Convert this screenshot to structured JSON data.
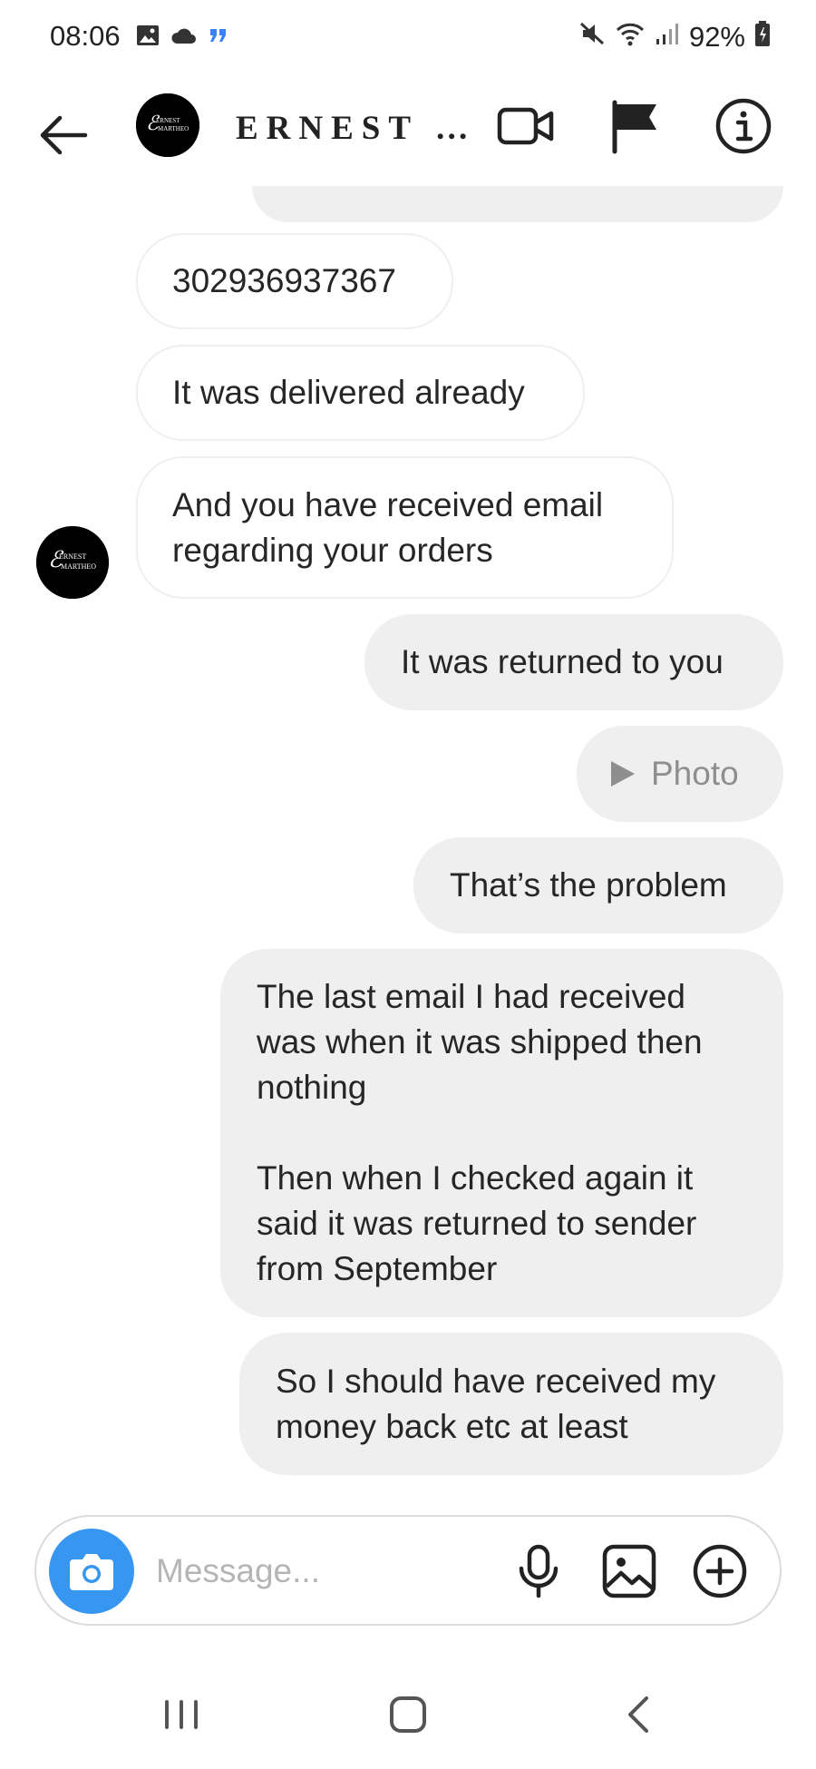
{
  "status_bar": {
    "time": "08:06",
    "battery": "92%"
  },
  "header": {
    "contact_name": "ERNEST …",
    "avatar_text": [
      "ERNEST",
      "MARTHEO"
    ]
  },
  "messages": [
    {
      "direction": "out",
      "text": "",
      "partial": true
    },
    {
      "direction": "in",
      "text": "302936937367"
    },
    {
      "direction": "in",
      "text": "It was delivered already"
    },
    {
      "direction": "in",
      "text": "And you have received email\nregarding your orders"
    },
    {
      "direction": "out",
      "text": "It was returned to you"
    },
    {
      "direction": "out",
      "text": "Photo",
      "type": "photo"
    },
    {
      "direction": "out",
      "text": "That’s the problem"
    },
    {
      "direction": "out",
      "text": "The last email I had received\nwas when it was shipped then\nnothing\n\nThen when I checked again it\nsaid it was returned to sender\nfrom September"
    },
    {
      "direction": "out",
      "text": "So I should have received my\nmoney back etc at least"
    }
  ],
  "composer": {
    "placeholder": "Message..."
  },
  "colors": {
    "accent": "#3797f0",
    "outgoing_bubble": "#efefef",
    "incoming_border": "#efefef",
    "photo_text": "#8e8e8e"
  },
  "icons": {
    "status_left": [
      "gallery-icon",
      "cloud-icon",
      "quote-icon"
    ],
    "status_right": [
      "mute-icon",
      "wifi-icon",
      "signal-icon",
      "battery-icon"
    ],
    "header": [
      "back-arrow-icon",
      "video-call-icon",
      "flag-icon",
      "info-icon"
    ],
    "composer": [
      "camera-icon",
      "microphone-icon",
      "gallery-icon",
      "plus-circle-icon"
    ],
    "navbar": [
      "recent-apps-icon",
      "home-icon",
      "back-icon"
    ]
  }
}
